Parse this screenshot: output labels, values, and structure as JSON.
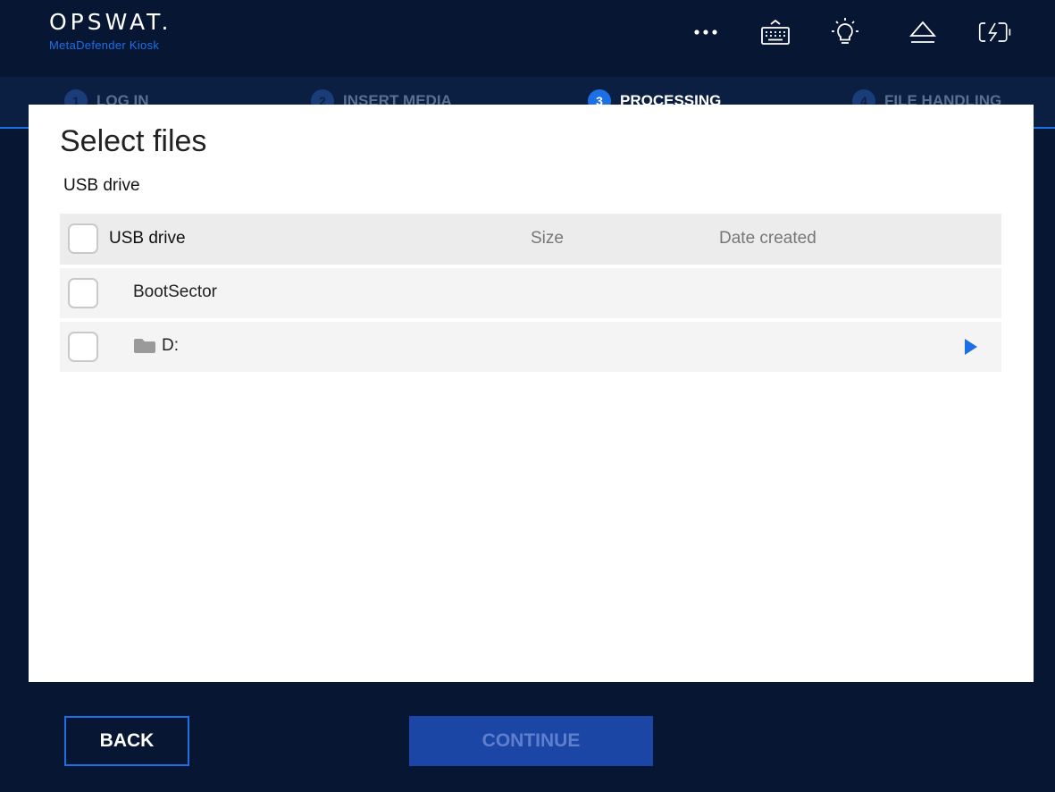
{
  "brand": {
    "name": "OPSWAT.",
    "product": "MetaDefender Kiosk",
    "accent_color": "#1d6fe6",
    "background_color": "#071733"
  },
  "header_icons": [
    "more-options-icon",
    "keyboard-icon",
    "lightbulb-icon",
    "eject-icon",
    "battery-charging-icon"
  ],
  "steps": [
    {
      "number": "1",
      "label": "LOG IN",
      "active": false
    },
    {
      "number": "2",
      "label": "INSERT MEDIA",
      "active": false
    },
    {
      "number": "3",
      "label": "PROCESSING",
      "active": true
    },
    {
      "number": "4",
      "label": "FILE HANDLING",
      "active": false
    }
  ],
  "dialog": {
    "title": "Select files",
    "breadcrumb": "USB drive",
    "table": {
      "columns": {
        "name": "USB drive",
        "size": "Size",
        "date": "Date created"
      },
      "rows": [
        {
          "name": "BootSector",
          "type": "file",
          "size": "",
          "date": ""
        },
        {
          "name": "D:",
          "type": "folder",
          "size": "",
          "date": ""
        }
      ]
    }
  },
  "footer": {
    "back_label": "BACK",
    "continue_label": "CONTINUE"
  }
}
